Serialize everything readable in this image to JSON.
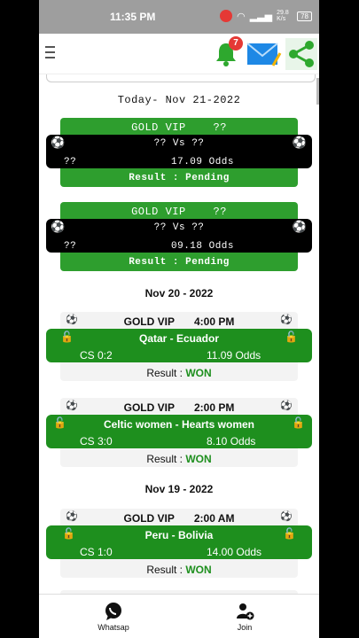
{
  "status": {
    "time": "11:35 PM",
    "battery": "78",
    "net": "29.8 K/s"
  },
  "header": {
    "notif_count": "7"
  },
  "pending": {
    "date": "Today- Nov 21-2022",
    "cards": [
      {
        "title": "GOLD VIP",
        "time": "??",
        "vs": "?? Vs ??",
        "left": "??",
        "odds": "17.09 Odds",
        "result": "Result : Pending"
      },
      {
        "title": "GOLD VIP",
        "time": "??",
        "vs": "?? Vs ??",
        "left": "??",
        "odds": "09.18 Odds",
        "result": "Result : Pending"
      }
    ]
  },
  "history": [
    {
      "date": "Nov 20 - 2022",
      "cards": [
        {
          "title": "GOLD VIP",
          "time": "4:00 PM",
          "match": "Qatar - Ecuador",
          "cs": "CS 0:2",
          "odds": "11.09 Odds",
          "result_label": "Result :",
          "result": "WON"
        },
        {
          "title": "GOLD VIP",
          "time": "2:00 PM",
          "match": "Celtic women - Hearts women",
          "cs": "CS 3:0",
          "odds": "8.10 Odds",
          "result_label": "Result :",
          "result": "WON"
        }
      ]
    },
    {
      "date": "Nov 19 - 2022",
      "cards": [
        {
          "title": "GOLD VIP",
          "time": "2:00 AM",
          "match": "Peru - Bolivia",
          "cs": "CS 1:0",
          "odds": "14.00 Odds",
          "result_label": "Result :",
          "result": "WON"
        }
      ]
    }
  ],
  "bottom_nav": [
    {
      "label": "Whatsap",
      "icon": "whatsapp-icon"
    },
    {
      "label": "Join",
      "icon": "join-icon"
    }
  ]
}
